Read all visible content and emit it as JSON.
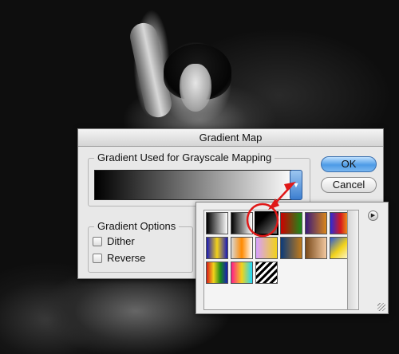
{
  "dialog": {
    "title": "Gradient Map",
    "gradient_group_label": "Gradient Used for Grayscale Mapping",
    "options_group_label": "Gradient Options",
    "dither_label": "Dither",
    "reverse_label": "Reverse",
    "ok_label": "OK",
    "cancel_label": "Cancel"
  },
  "picker": {
    "swatches": [
      "linear-gradient(90deg,#000,#fff)",
      "linear-gradient(90deg,#000,#fff)",
      "linear-gradient(135deg,#000 30%,#777)",
      "linear-gradient(90deg,#c00,#1a8a1a)",
      "linear-gradient(90deg,#3a1a7a,#d9861a)",
      "linear-gradient(90deg,#2a2ad8,#d81a1a,#f2d21a)",
      "linear-gradient(90deg,#1a1ab8,#f2d21a,#1a1ab8)",
      "linear-gradient(90deg,#d8d8d8,#ff8a00,#fff)",
      "linear-gradient(90deg,#d8a0ff,#f2d21a)",
      "linear-gradient(90deg,#0a3a7a,#c07a1a)",
      "linear-gradient(90deg,#7a4a1a,#f2c8a0)",
      "linear-gradient(135deg,#2a5ad8,#f2d21a,#ffe)",
      "linear-gradient(90deg,#d81a1a,#f2d21a,#1a8a1a,#1a1ab8)",
      "linear-gradient(90deg,#ff1a8a,#f2d21a,#1ad8ff)",
      "repeating-linear-gradient(135deg,#000 0 3px,#fff 3px 6px)"
    ],
    "selected_index": 2
  }
}
